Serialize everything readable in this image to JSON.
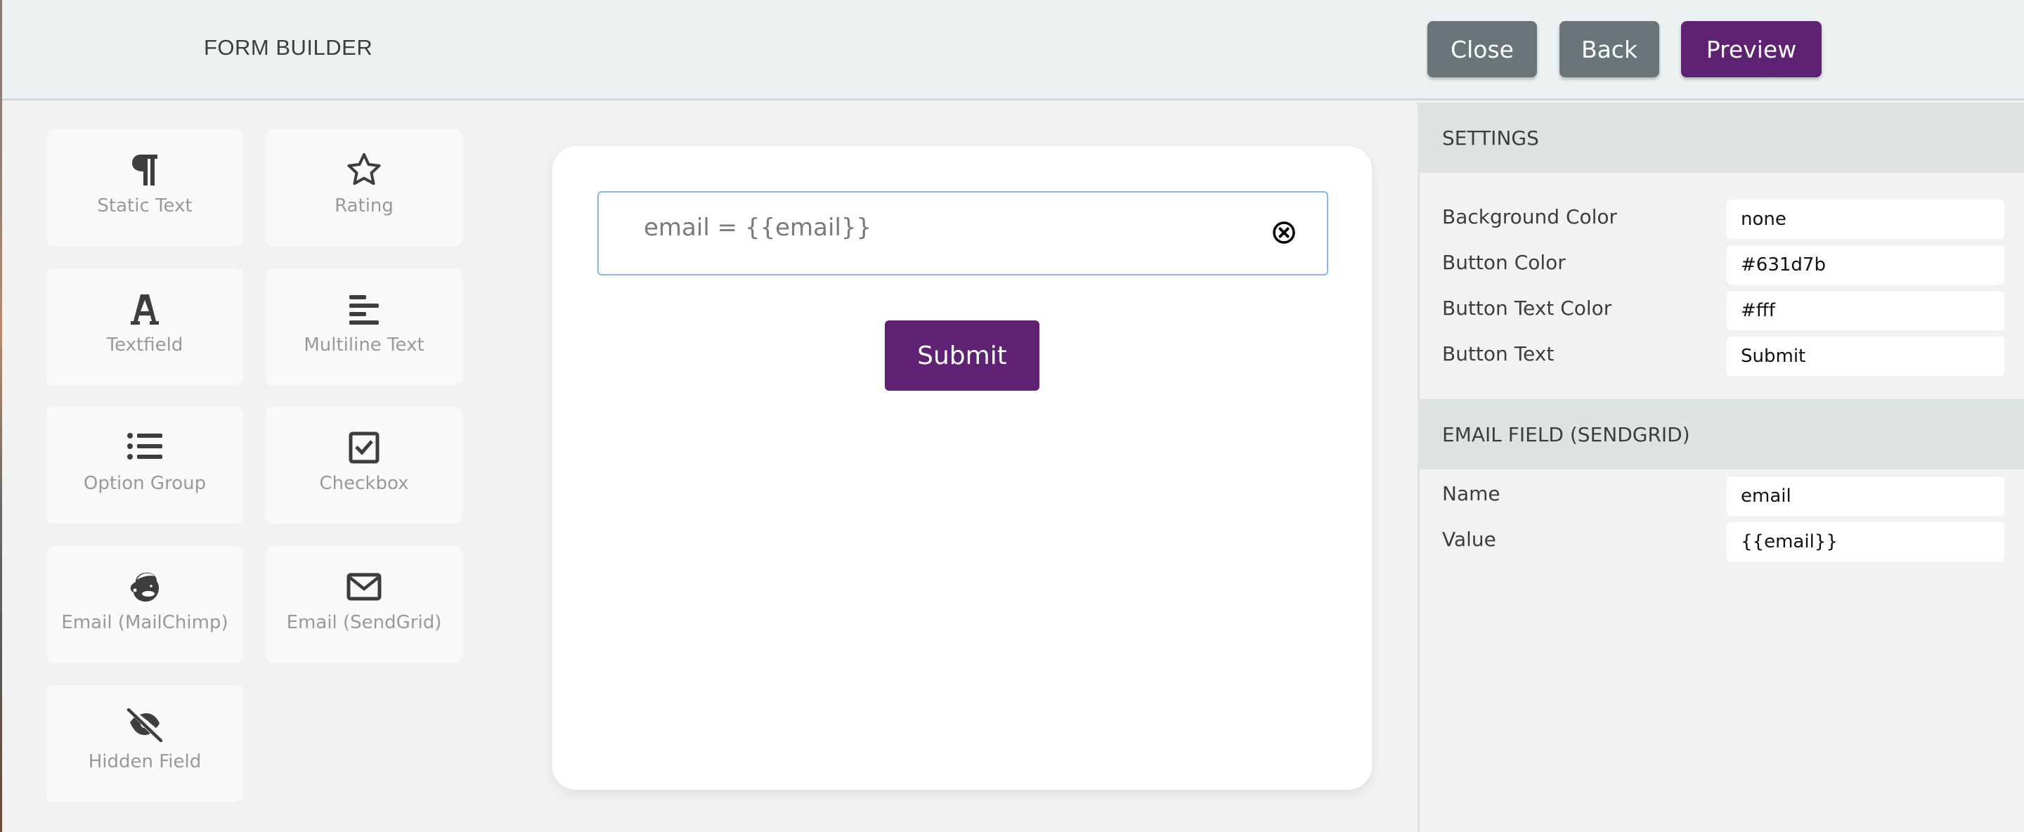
{
  "header": {
    "title": "FORM BUILDER",
    "buttons": {
      "close": "Close",
      "back": "Back",
      "preview": "Preview"
    }
  },
  "palette": {
    "items": [
      {
        "label": "Static Text",
        "icon": "paragraph-icon"
      },
      {
        "label": "Rating",
        "icon": "star-icon"
      },
      {
        "label": "Textfield",
        "icon": "letter-a-icon"
      },
      {
        "label": "Multiline Text",
        "icon": "align-left-icon"
      },
      {
        "label": "Option Group",
        "icon": "list-icon"
      },
      {
        "label": "Checkbox",
        "icon": "checkbox-icon"
      },
      {
        "label": "Email (MailChimp)",
        "icon": "mailchimp-icon"
      },
      {
        "label": "Email (SendGrid)",
        "icon": "envelope-icon"
      },
      {
        "label": "Hidden Field",
        "icon": "eye-slash-icon"
      }
    ]
  },
  "canvas": {
    "fields": [
      {
        "text": "email = {{email}}",
        "remove_icon": "remove-circle-icon"
      }
    ],
    "submit_label": "Submit"
  },
  "settings": {
    "title": "SETTINGS",
    "rows": [
      {
        "label": "Background Color",
        "value": "none"
      },
      {
        "label": "Button Color",
        "value": "#631d7b"
      },
      {
        "label": "Button Text Color",
        "value": "#fff"
      },
      {
        "label": "Button Text",
        "value": "Submit"
      }
    ]
  },
  "field_settings": {
    "title": "EMAIL FIELD (SENDGRID)",
    "rows": [
      {
        "label": "Name",
        "value": "email"
      },
      {
        "label": "Value",
        "value": "{{email}}"
      }
    ]
  },
  "colors": {
    "accent": "#5e2173",
    "secondary_button": "#6a757a",
    "header_bg": "#ecf2f2",
    "section_header_bg": "#dde3e3",
    "field_focus_border": "#85b6f2"
  }
}
